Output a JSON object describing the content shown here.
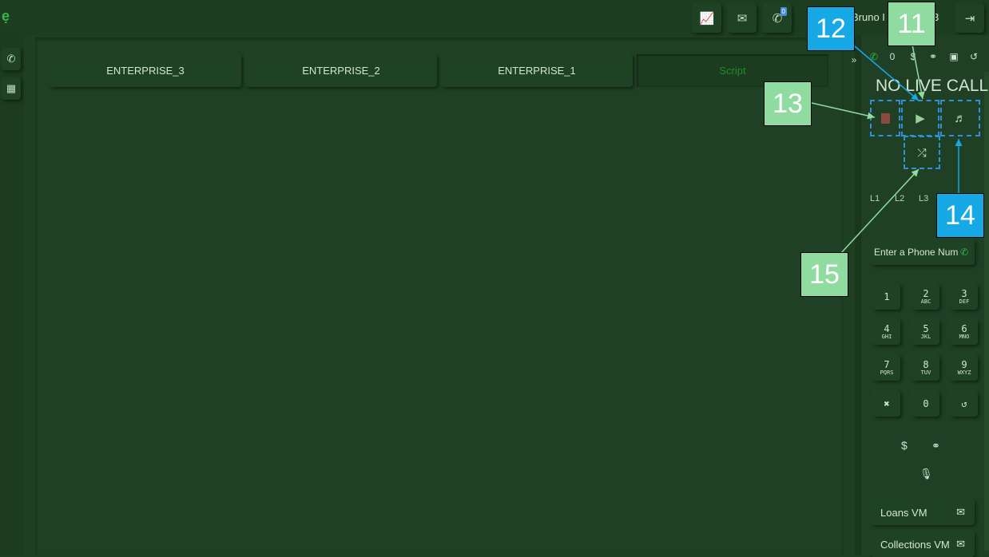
{
  "header": {
    "user_name": "Bruno I",
    "user_suffix": "3",
    "voicemail_badge": "0",
    "icons": [
      "chart-line-icon",
      "envelope-icon",
      "phone-voicemail-icon",
      "sign-out-icon"
    ]
  },
  "tabs": [
    {
      "label": "ENTERPRISE_3"
    },
    {
      "label": "ENTERPRISE_2"
    },
    {
      "label": "ENTERPRISE_1"
    },
    {
      "label": "Script"
    }
  ],
  "right_panel": {
    "counter": "0",
    "status": "NO LIVE CALL",
    "lines": [
      "L1",
      "L2",
      "L3"
    ],
    "phone_placeholder": "Enter a Phone Num",
    "keypad": [
      {
        "digit": "1",
        "sub": ""
      },
      {
        "digit": "2",
        "sub": "ABC"
      },
      {
        "digit": "3",
        "sub": "DEF"
      },
      {
        "digit": "4",
        "sub": "GHI"
      },
      {
        "digit": "5",
        "sub": "JKL"
      },
      {
        "digit": "6",
        "sub": "MNO"
      },
      {
        "digit": "7",
        "sub": "PQRS"
      },
      {
        "digit": "8",
        "sub": "TUV"
      },
      {
        "digit": "9",
        "sub": "WXYZ"
      },
      {
        "digit": "✖",
        "sub": ""
      },
      {
        "digit": "0",
        "sub": ""
      },
      {
        "digit": "↺",
        "sub": ""
      }
    ],
    "voicemails": [
      "Loans VM",
      "Collections VM"
    ]
  },
  "annotations": [
    "11",
    "12",
    "13",
    "14",
    "15"
  ],
  "colors": {
    "accent_green": "#1f8c2a",
    "callout_green": "#90dca0",
    "callout_blue": "#17a8e6"
  }
}
